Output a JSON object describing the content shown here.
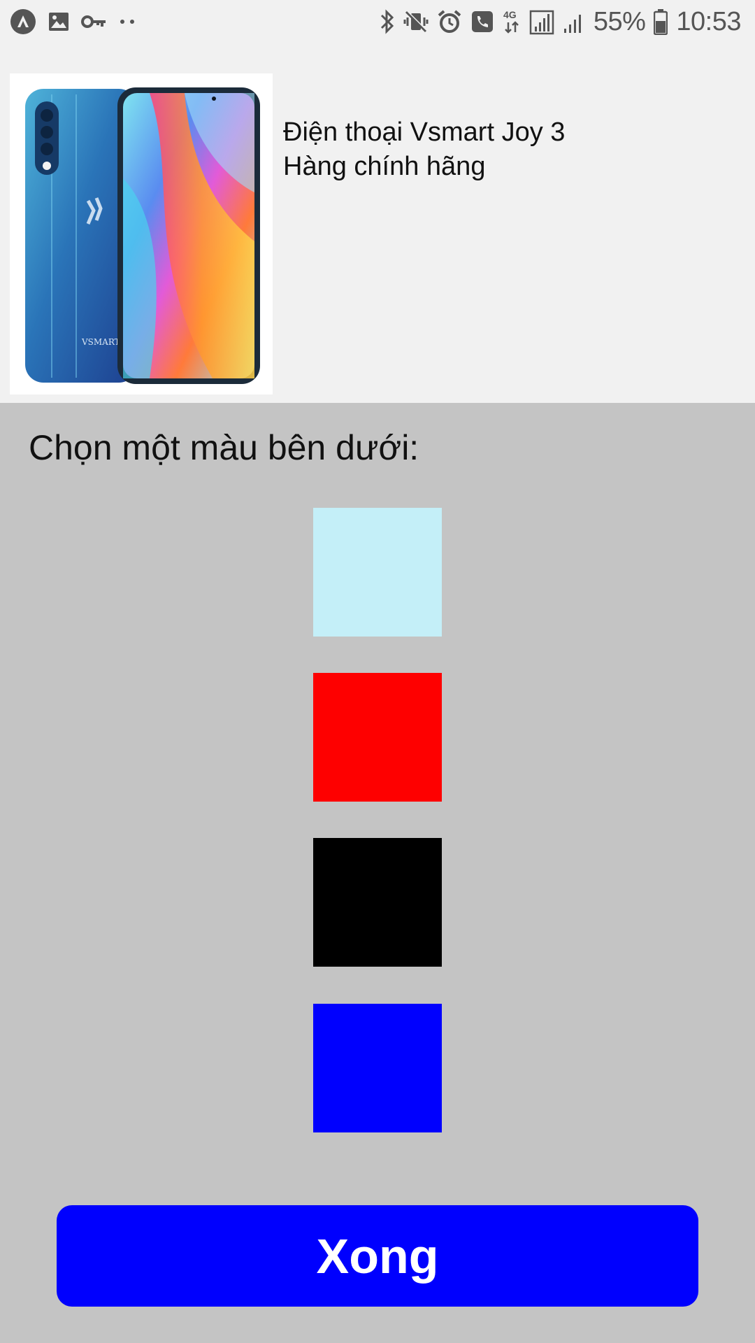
{
  "status_bar": {
    "left_icons": [
      "app-logo-icon",
      "image-icon",
      "vpn-key-icon",
      "more-dots-icon"
    ],
    "right_icons": [
      "bluetooth-icon",
      "vibrate-mute-icon",
      "alarm-icon",
      "wifi-call-icon",
      "network-4g-icon",
      "signal-icon",
      "signal-icon-2",
      "battery-icon"
    ],
    "battery_percent": "55%",
    "time": "10:53",
    "network_label": "4G"
  },
  "product": {
    "image_icon": "phone-product-image",
    "image_brand_text": "VSMART",
    "title_line1": "Điện thoại Vsmart Joy 3",
    "title_line2": "Hàng chính hãng"
  },
  "chooser": {
    "label": "Chọn một màu bên dưới:",
    "colors": [
      "#c4eff8",
      "#fe0000",
      "#000000",
      "#0000fe"
    ]
  },
  "done_button": {
    "label": "Xong",
    "color": "#0000fe"
  }
}
